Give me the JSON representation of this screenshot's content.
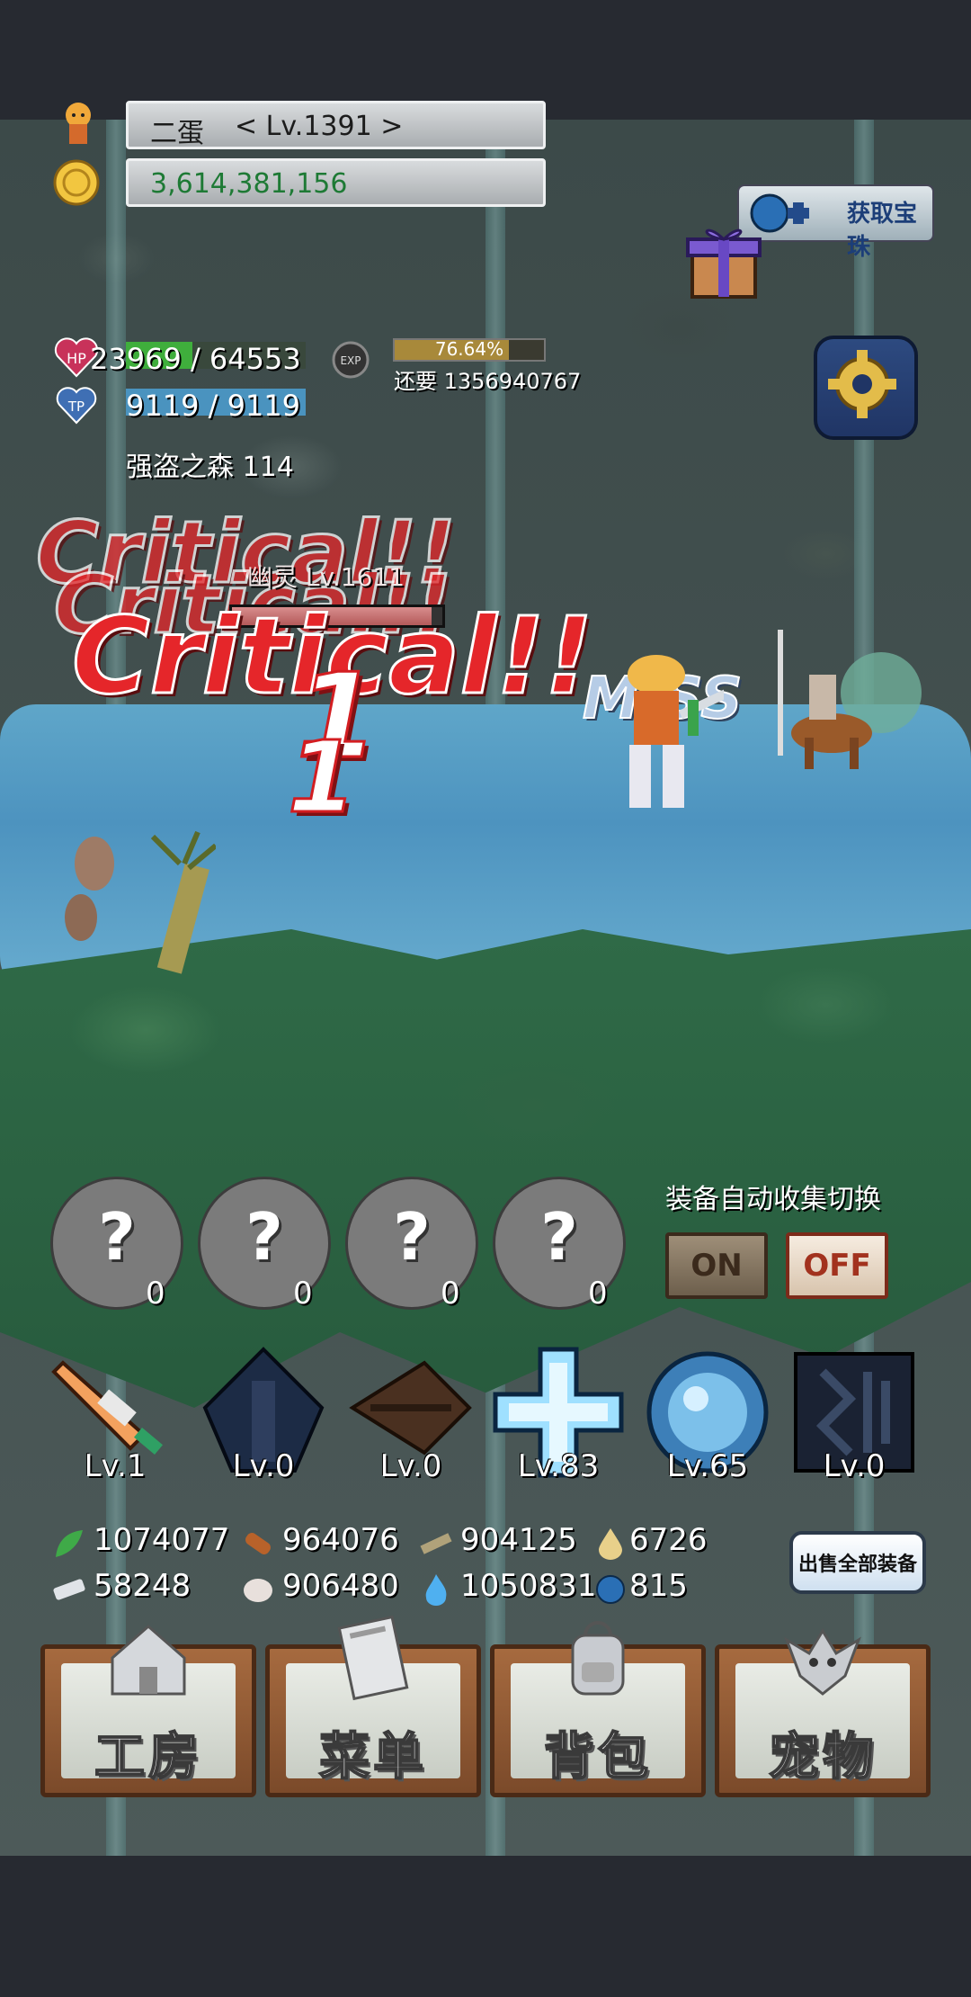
{
  "player": {
    "name": "二蛋",
    "level_text": "< Lv.1391 >",
    "gold": "3,614,381,156",
    "hp_text": "23969 / 64553",
    "hp_fraction": 0.371,
    "tp_text": "9119 / 9119",
    "tp_fraction": 1.0,
    "exp_percent_text": "76.64%",
    "exp_fraction": 0.7664,
    "exp_remaining": "还要 1356940767",
    "location": "强盗之森 114"
  },
  "icons": {
    "hp_badge": "HP",
    "tp_badge": "TP",
    "exp_badge": "EXP",
    "gem_button_label": "获取宝珠"
  },
  "battle": {
    "enemy_name": "幽灵 Lv.1611",
    "enemy_hp_fraction": 0.95,
    "critical_text": "Critical!!",
    "damage_text": "1",
    "miss_text": "MISS"
  },
  "auto_collect": {
    "label": "装备自动收集切换",
    "on_label": "ON",
    "off_label": "OFF"
  },
  "slots": [
    {
      "symbol": "?",
      "count": "0"
    },
    {
      "symbol": "?",
      "count": "0"
    },
    {
      "symbol": "?",
      "count": "0"
    },
    {
      "symbol": "?",
      "count": "0"
    }
  ],
  "equipment": [
    {
      "name": "feather-sword",
      "level": "Lv.1",
      "color": "#f3a15e"
    },
    {
      "name": "dark-armor",
      "level": "Lv.0",
      "color": "#1c2b45"
    },
    {
      "name": "brown-claw",
      "level": "Lv.0",
      "color": "#4a3020"
    },
    {
      "name": "ice-cross",
      "level": "Lv.83",
      "color": "#9fe0ff"
    },
    {
      "name": "blue-orb",
      "level": "Lv.65",
      "color": "#5aa7e0"
    },
    {
      "name": "shadow-gear",
      "level": "Lv.0",
      "color": "#1a2233"
    }
  ],
  "resources": {
    "herb": "1074077",
    "wood": "964076",
    "plank": "904125",
    "drop": "6726",
    "ingot": "58248",
    "stone": "906480",
    "flame": "1050831",
    "orb": "815"
  },
  "sell_all_label": "出售全部装备",
  "menu": {
    "workshop": "工房",
    "menu": "菜单",
    "backpack": "背包",
    "pet": "宠物"
  },
  "colors": {
    "hp_fill": "#3fae3c",
    "tp_fill": "#3c7fa6",
    "gold_text": "#1e7a35",
    "critical": "#e5262a"
  }
}
